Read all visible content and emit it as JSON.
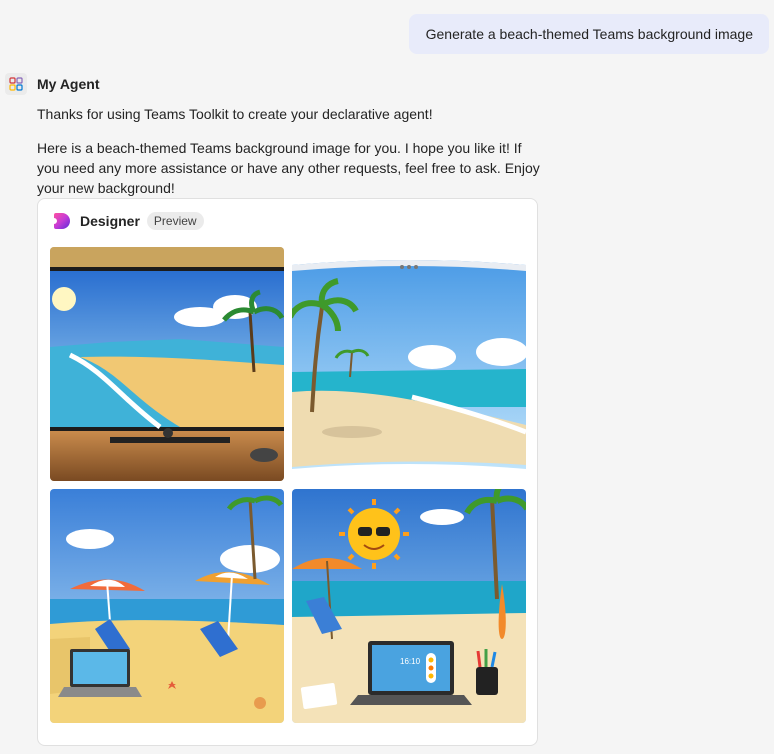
{
  "user_message": "Generate a beach-themed Teams background image",
  "agent": {
    "name": "My Agent",
    "icon": "app-grid-icon"
  },
  "response": {
    "line1": "Thanks for using Teams Toolkit to create your declarative agent!",
    "line2": "Here is a beach-themed Teams background image for you. I hope you like it! If you need any more assistance or have any other requests, feel free to ask. Enjoy your new background!"
  },
  "card": {
    "title": "Designer",
    "badge": "Preview",
    "logo_icon": "designer-logo-icon",
    "images": [
      {
        "name": "beach-monitor-image"
      },
      {
        "name": "beach-curved-screen-image"
      },
      {
        "name": "beach-umbrellas-laptop-image"
      },
      {
        "name": "beach-sun-laptop-image"
      }
    ],
    "laptop_clock": "16:10"
  },
  "colors": {
    "user_bubble": "#e8ebfa",
    "background": "#f5f5f5",
    "card_border": "#e0e0e0"
  }
}
